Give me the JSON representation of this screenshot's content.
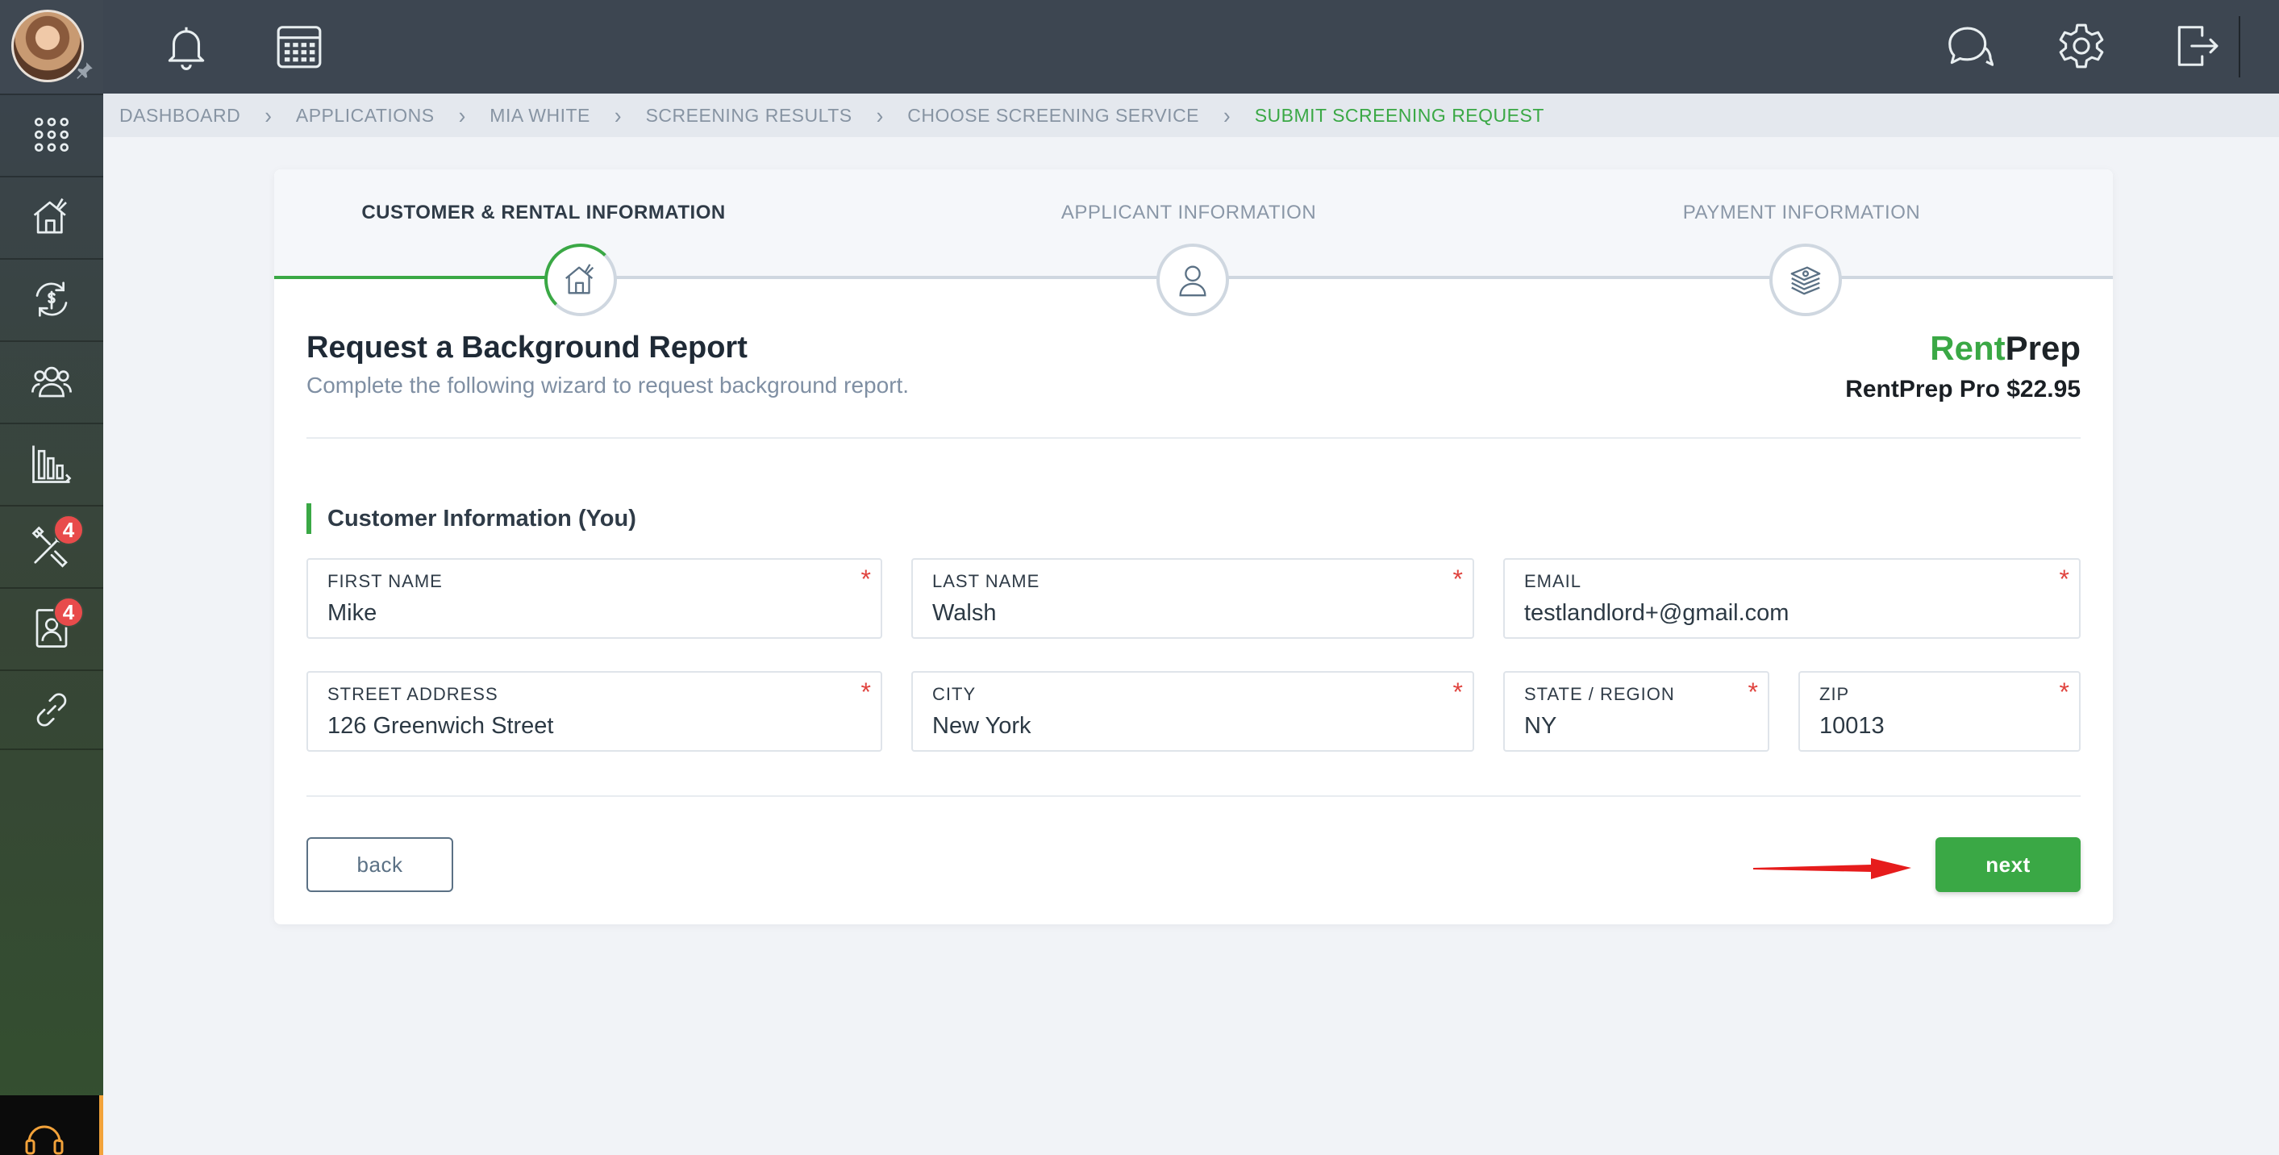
{
  "sidebar": {
    "items": [
      {
        "icon": "apps-grid-icon"
      },
      {
        "icon": "house-tools-icon"
      },
      {
        "icon": "money-cycle-icon"
      },
      {
        "icon": "people-icon"
      },
      {
        "icon": "bar-chart-icon"
      },
      {
        "icon": "tools-icon",
        "badge": "4"
      },
      {
        "icon": "contact-card-icon",
        "badge": "4"
      },
      {
        "icon": "link-icon"
      }
    ],
    "support_icon": "headset-icon"
  },
  "topbar": {
    "left_icons": [
      "bell-icon",
      "calendar-icon"
    ],
    "right_icons": [
      "chat-icon",
      "gear-icon",
      "logout-icon"
    ]
  },
  "breadcrumb": [
    "DASHBOARD",
    "APPLICATIONS",
    "MIA WHITE",
    "SCREENING RESULTS",
    "CHOOSE SCREENING SERVICE",
    "SUBMIT SCREENING REQUEST"
  ],
  "steps": [
    {
      "label": "CUSTOMER & RENTAL INFORMATION",
      "active": true,
      "icon": "house-icon"
    },
    {
      "label": "APPLICANT INFORMATION",
      "active": false,
      "icon": "person-icon"
    },
    {
      "label": "PAYMENT INFORMATION",
      "active": false,
      "icon": "cash-stack-icon"
    }
  ],
  "header": {
    "title": "Request a Background Report",
    "subtitle": "Complete the following wizard to request background report.",
    "logo_rent": "Rent",
    "logo_prep": "Prep",
    "price": "RentPrep Pro $22.95"
  },
  "section_title": "Customer Information (You)",
  "fields": {
    "first_name": {
      "label": "FIRST NAME",
      "value": "Mike"
    },
    "last_name": {
      "label": "LAST NAME",
      "value": "Walsh"
    },
    "email": {
      "label": "EMAIL",
      "value": "testlandlord+@gmail.com"
    },
    "street": {
      "label": "STREET ADDRESS",
      "value": "126 Greenwich Street"
    },
    "city": {
      "label": "CITY",
      "value": "New York"
    },
    "state": {
      "label": "STATE / REGION",
      "value": "NY"
    },
    "zip": {
      "label": "ZIP",
      "value": "10013"
    },
    "required_mark": "*"
  },
  "buttons": {
    "back": "back",
    "next": "next"
  },
  "colors": {
    "accent": "#3aa845",
    "required": "#e0443f",
    "badge": "#e84b4b"
  }
}
